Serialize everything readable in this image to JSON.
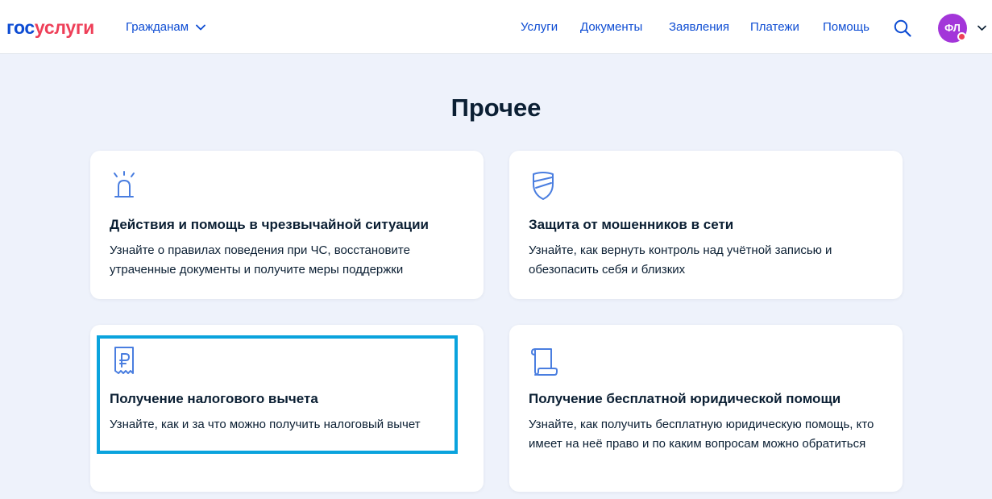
{
  "header": {
    "logo_part1": "гос",
    "logo_part2": "услуги",
    "audience_label": "Гражданам",
    "nav": [
      "Услуги",
      "Документы",
      "Заявления",
      "Платежи",
      "Помощь"
    ],
    "avatar_initials": "ФЛ",
    "icons": {
      "search": "search-icon",
      "audience_dropdown": "chevron-down-icon",
      "profile_dropdown": "chevron-down-icon"
    }
  },
  "page": {
    "title": "Прочее"
  },
  "cards": [
    {
      "title": "Действия и помощь в чрезвычайной ситуации",
      "description": "Узнайте о правилах поведения при ЧС, восстановите утраченные документы и получите меры поддержки",
      "icon": "siren-icon"
    },
    {
      "title": "Защита от мошенников в сети",
      "description": "Узнайте, как вернуть контроль над учётной записью и обезопасить себя и близких",
      "icon": "shield-icon"
    },
    {
      "title": "Получение налогового вычета",
      "description": "Узнайте, как и за что можно получить налоговый вычет",
      "icon": "ruble-receipt-icon"
    },
    {
      "title": "Получение бесплатной юридической помощи",
      "description": "Узнайте, как получить бесплатную юридическую помощь, кто имеет на неё право и по каким вопросам можно обратиться",
      "icon": "scroll-icon"
    }
  ],
  "colors": {
    "brand_blue": "#0d4cd3",
    "brand_red": "#ee3f58",
    "page_background": "#eef2fb",
    "icon_blue": "#4a7ee0",
    "avatar_purple": "#a336d9",
    "highlight_cyan": "#0aa3dd"
  }
}
